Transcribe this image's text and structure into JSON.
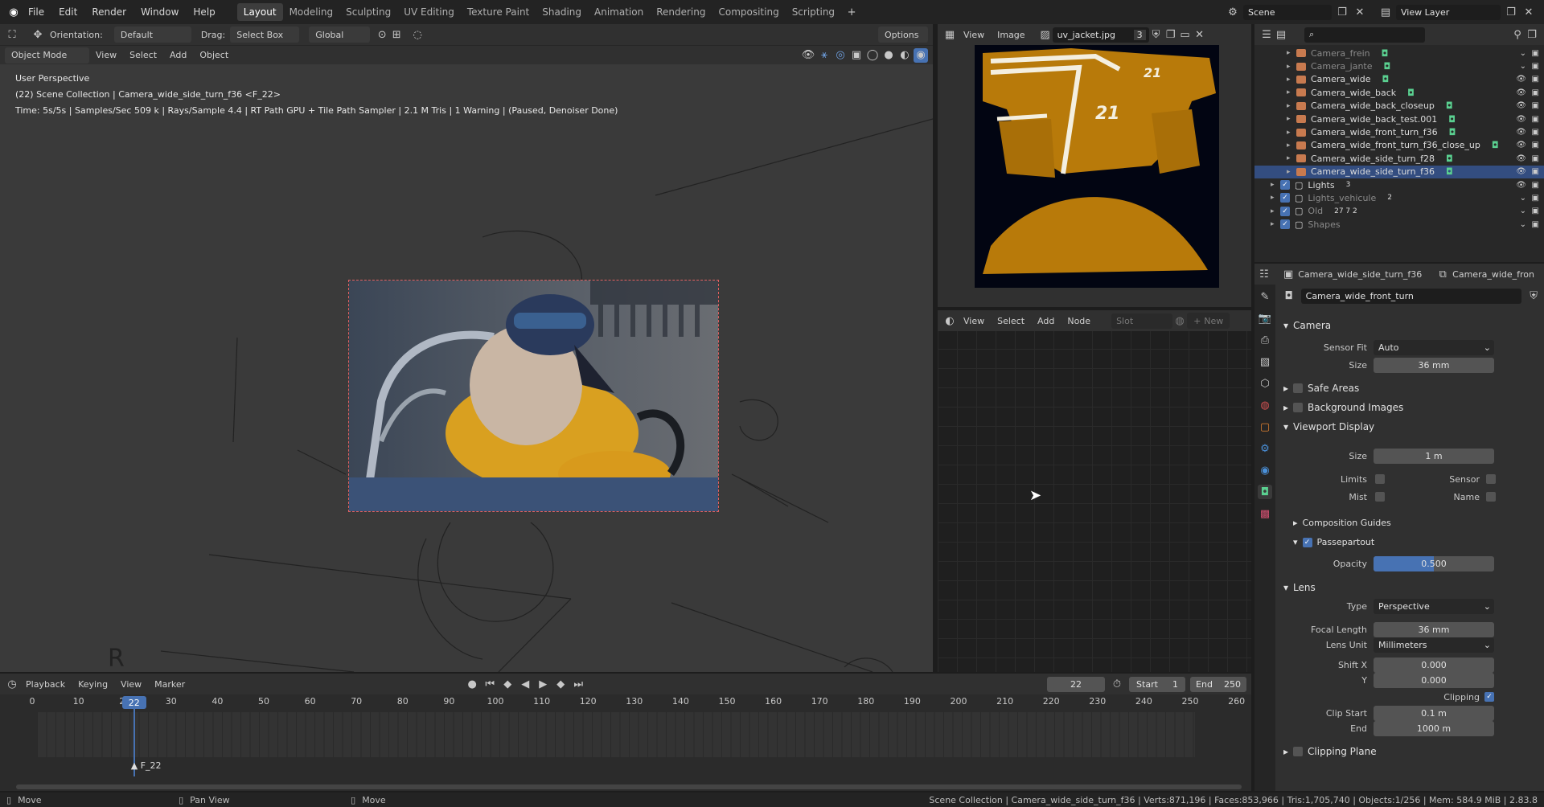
{
  "menu": [
    "File",
    "Edit",
    "Render",
    "Window",
    "Help"
  ],
  "workspaces": [
    "Layout",
    "Modeling",
    "Sculpting",
    "UV Editing",
    "Texture Paint",
    "Shading",
    "Animation",
    "Rendering",
    "Compositing",
    "Scripting"
  ],
  "active_workspace": "Layout",
  "scene": {
    "name": "Scene",
    "view_layer": "View Layer"
  },
  "viewport": {
    "orientation_label": "Orientation:",
    "orientation_value": "Default",
    "drag_label": "Drag:",
    "drag_value": "Select Box",
    "transform_value": "Global",
    "options_label": "Options",
    "mode": "Object Mode",
    "menus": [
      "View",
      "Select",
      "Add",
      "Object"
    ],
    "overlay_line1": "User Perspective",
    "overlay_line2": "(22) Scene Collection | Camera_wide_side_turn_f36 <F_22>",
    "overlay_line3": "Time: 5s/5s | Samples/Sec 509 k | Rays/Sample 4.4 | RT Path GPU + Tile Path Sampler | 2.1 M Tris | 1 Warning | (Paused, Denoiser Done)",
    "corner_text": "R"
  },
  "image_editor": {
    "menus": [
      "View",
      "Image"
    ],
    "image_name": "uv_jacket.jpg",
    "users": "3",
    "jersey_number": "21"
  },
  "node_editor": {
    "menus": [
      "View",
      "Select",
      "Add",
      "Node"
    ],
    "slot": "Slot",
    "new": "New"
  },
  "outliner": {
    "items": [
      {
        "name": "Camera_frein",
        "dim": true
      },
      {
        "name": "Camera_jante",
        "dim": true
      },
      {
        "name": "Camera_wide",
        "dim": false
      },
      {
        "name": "Camera_wide_back",
        "dim": false
      },
      {
        "name": "Camera_wide_back_closeup",
        "dim": false
      },
      {
        "name": "Camera_wide_back_test.001",
        "dim": false
      },
      {
        "name": "Camera_wide_front_turn_f36",
        "dim": false
      },
      {
        "name": "Camera_wide_front_turn_f36_close_up",
        "dim": false
      },
      {
        "name": "Camera_wide_side_turn_f28",
        "dim": false
      },
      {
        "name": "Camera_wide_side_turn_f36",
        "selected": true
      },
      {
        "name": "Lights",
        "collection": true,
        "badge": "3"
      },
      {
        "name": "Lights_vehicule",
        "collection": true,
        "dim": true,
        "badge": "2"
      },
      {
        "name": "Old",
        "collection": true,
        "dim": true,
        "badge": "27  7  2"
      },
      {
        "name": "Shapes",
        "collection": true,
        "dim": true
      }
    ]
  },
  "properties": {
    "object_name": "Camera_wide_side_turn_f36",
    "data_name_tab": "Camera_wide_fron",
    "datablock": "Camera_wide_front_turn",
    "camera_section": "Camera",
    "sensor_fit_label": "Sensor Fit",
    "sensor_fit": "Auto",
    "size_label": "Size",
    "size": "36 mm",
    "safe_areas": "Safe Areas",
    "background_images": "Background Images",
    "viewport_display": "Viewport Display",
    "vd_size": "1 m",
    "limits": "Limits",
    "sensor": "Sensor",
    "mist": "Mist",
    "name": "Name",
    "composition_guides": "Composition Guides",
    "passepartout": "Passepartout",
    "opacity_label": "Opacity",
    "opacity": "0.500",
    "opacity_value": 0.5,
    "lens_section": "Lens",
    "type_label": "Type",
    "type": "Perspective",
    "focal_length_label": "Focal Length",
    "focal_length": "36 mm",
    "lens_unit_label": "Lens Unit",
    "lens_unit": "Millimeters",
    "shift_x_label": "Shift X",
    "shift_x": "0.000",
    "shift_y_label": "Y",
    "shift_y": "0.000",
    "clipping": "Clipping",
    "clip_start_label": "Clip Start",
    "clip_start": "0.1 m",
    "clip_end_label": "End",
    "clip_end": "1000 m",
    "clipping_plane": "Clipping Plane"
  },
  "timeline": {
    "menus": [
      "Playback",
      "Keying",
      "View",
      "Marker"
    ],
    "current_frame": "22",
    "start_label": "Start",
    "start": "1",
    "end_label": "End",
    "end": "250",
    "ticks": [
      "0",
      "10",
      "20",
      "30",
      "40",
      "50",
      "60",
      "70",
      "80",
      "90",
      "100",
      "110",
      "120",
      "130",
      "140",
      "150",
      "160",
      "170",
      "180",
      "190",
      "200",
      "210",
      "220",
      "230",
      "240",
      "250",
      "260"
    ],
    "marker": "F_22"
  },
  "statusbar": {
    "left1": "Move",
    "left2": "Pan View",
    "left3": "Move",
    "right": "Scene Collection | Camera_wide_side_turn_f36 | Verts:871,196 | Faces:853,966 | Tris:1,705,740 | Objects:1/256 | Mem: 584.9 MiB | 2.83.8"
  },
  "colors": {
    "accent": "#4772b3",
    "selection": "#334d80",
    "camera_icon": "#c87a4f",
    "jacket": "#b87a0a"
  }
}
